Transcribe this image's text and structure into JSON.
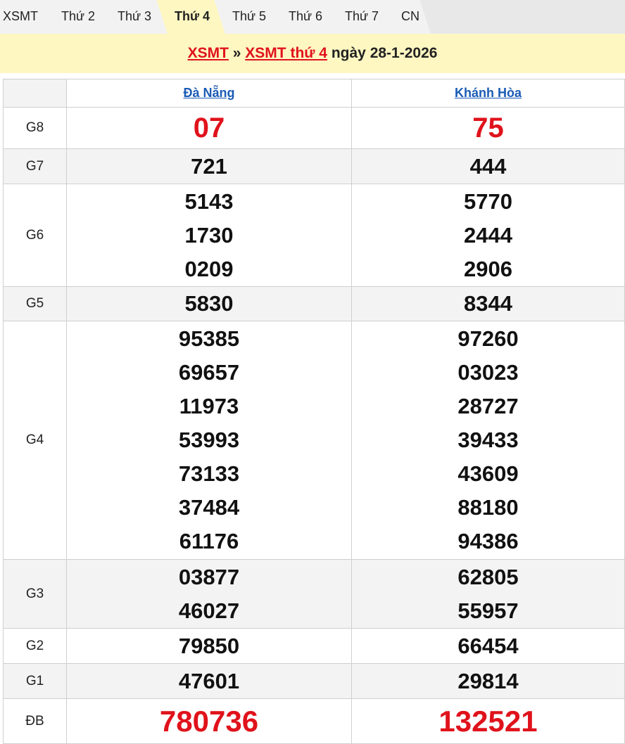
{
  "tabs": [
    "XSMT",
    "Thứ 2",
    "Thứ 3",
    "Thứ 4",
    "Thứ 5",
    "Thứ 6",
    "Thứ 7",
    "CN"
  ],
  "header": {
    "link1": "XSMT",
    "sep": "»",
    "link2": "XSMT thứ 4",
    "date_text": "ngày 28-1-2026"
  },
  "provinces": [
    "Đà Nẵng",
    "Khánh Hòa"
  ],
  "prizes": {
    "g8": {
      "label": "G8",
      "a": "07",
      "b": "75"
    },
    "g7": {
      "label": "G7",
      "a": "721",
      "b": "444"
    },
    "g6": {
      "label": "G6",
      "a": [
        "5143",
        "1730",
        "0209"
      ],
      "b": [
        "5770",
        "2444",
        "2906"
      ]
    },
    "g5": {
      "label": "G5",
      "a": "5830",
      "b": "8344"
    },
    "g4": {
      "label": "G4",
      "a": [
        "95385",
        "69657",
        "11973",
        "53993",
        "73133",
        "37484",
        "61176"
      ],
      "b": [
        "97260",
        "03023",
        "28727",
        "39433",
        "43609",
        "88180",
        "94386"
      ]
    },
    "g3": {
      "label": "G3",
      "a": [
        "03877",
        "46027"
      ],
      "b": [
        "62805",
        "55957"
      ]
    },
    "g2": {
      "label": "G2",
      "a": "79850",
      "b": "66454"
    },
    "g1": {
      "label": "G1",
      "a": "47601",
      "b": "29814"
    },
    "db": {
      "label": "ĐB",
      "a": "780736",
      "b": "132521"
    }
  },
  "colors": {
    "accent_red": "#e0121b",
    "link_blue": "#1a5bb5",
    "header_bg": "#fff7c2"
  }
}
